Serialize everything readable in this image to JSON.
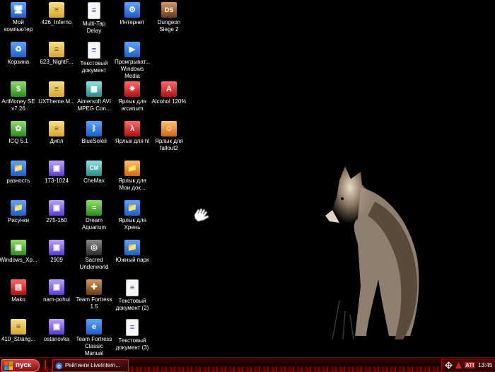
{
  "desktop": {
    "icons": [
      {
        "label": "Мой компьютер",
        "icon": "my-computer-icon",
        "glyph": "🖥"
      },
      {
        "label": "Корзина",
        "icon": "recycle-bin-icon",
        "glyph": "♻"
      },
      {
        "label": "ArtMoney SE v7.26",
        "icon": "artmoney-icon",
        "glyph": "$"
      },
      {
        "label": "ICQ 5.1",
        "icon": "icq-icon",
        "glyph": "✿"
      },
      {
        "label": "разность",
        "icon": "folder-icon",
        "glyph": "📁"
      },
      {
        "label": "Рисунки",
        "icon": "folder-icon",
        "glyph": "📁"
      },
      {
        "label": "Windows_Xp...",
        "icon": "image-file-icon",
        "glyph": "▣"
      },
      {
        "label": "Mako",
        "icon": "archive-icon",
        "glyph": "▤"
      },
      {
        "label": "410_Strang...",
        "icon": "document-icon",
        "glyph": "≡"
      },
      {
        "label": "426_Inferno",
        "icon": "document-icon",
        "glyph": "≡"
      },
      {
        "label": "623_NightF...",
        "icon": "document-icon",
        "glyph": "≡"
      },
      {
        "label": "UXTheme.M...",
        "icon": "document-icon",
        "glyph": "≡"
      },
      {
        "label": "Дипл",
        "icon": "document-icon",
        "glyph": "≡"
      },
      {
        "label": "173-1024",
        "icon": "image-file-icon",
        "glyph": "▣"
      },
      {
        "label": "275-160",
        "icon": "image-file-icon",
        "glyph": "▣"
      },
      {
        "label": "2909",
        "icon": "image-file-icon",
        "glyph": "▣"
      },
      {
        "label": "nam-pohui",
        "icon": "image-file-icon",
        "glyph": "▣"
      },
      {
        "label": "ostanovka",
        "icon": "image-file-icon",
        "glyph": "▣"
      },
      {
        "label": "Multi-Tap Delay",
        "icon": "document-icon",
        "glyph": "≡"
      },
      {
        "label": "Текстовый документ",
        "icon": "text-document-icon",
        "glyph": "≡"
      },
      {
        "label": "Aimersoft AVI MPEG Con...",
        "icon": "film-icon",
        "glyph": "▦"
      },
      {
        "label": "BlueSoleil",
        "icon": "bluetooth-icon",
        "glyph": "ᛒ"
      },
      {
        "label": "CheMax",
        "icon": "chemax-icon",
        "glyph": "CM"
      },
      {
        "label": "Dream Aquarium",
        "icon": "aquarium-icon",
        "glyph": "≈"
      },
      {
        "label": "Sacred Underworld",
        "icon": "sacred-icon",
        "glyph": "◎"
      },
      {
        "label": "Team Fortress 1.5",
        "icon": "team-fortress-icon",
        "glyph": "✚"
      },
      {
        "label": "Team Fortress Classic Manual",
        "icon": "ie-document-icon",
        "glyph": "e"
      },
      {
        "label": "Интернет",
        "icon": "internet-icon",
        "glyph": "⚙"
      },
      {
        "label": "Проигрыват... Windows Media",
        "icon": "windows-media-icon",
        "glyph": "▶"
      },
      {
        "label": "Ярлык для arcanum",
        "icon": "arcanum-icon",
        "glyph": "✷"
      },
      {
        "label": "Ярлык для hl",
        "icon": "half-life-icon",
        "glyph": "λ"
      },
      {
        "label": "Ярлык для Мои док...",
        "icon": "folder-shortcut-icon",
        "glyph": "📁"
      },
      {
        "label": "Ярлык для Хрень",
        "icon": "folder-shortcut-icon",
        "glyph": "📁"
      },
      {
        "label": "Южный парк",
        "icon": "folder-icon",
        "glyph": "📁"
      },
      {
        "label": "Текстовый документ (2)",
        "icon": "text-document-icon",
        "glyph": "≡"
      },
      {
        "label": "Текстовый документ (3)",
        "icon": "text-document-icon",
        "glyph": "≡"
      },
      {
        "label": "Dungeon Siege 2",
        "icon": "dungeon-siege-icon",
        "glyph": "DS"
      },
      {
        "label": "Alcohol 120%",
        "icon": "alcohol-icon",
        "glyph": "A"
      },
      {
        "label": "Ярлык для fallout2",
        "icon": "fallout-icon",
        "glyph": "☺"
      }
    ]
  },
  "taskbar": {
    "start_label": "пуск",
    "task_label": "Рейтинги LiveIntern...",
    "tray": {
      "clock": "13:45",
      "icons": [
        "network-icon",
        "ati-icon",
        "ati-label-icon"
      ],
      "ati_text": "ATI"
    }
  }
}
